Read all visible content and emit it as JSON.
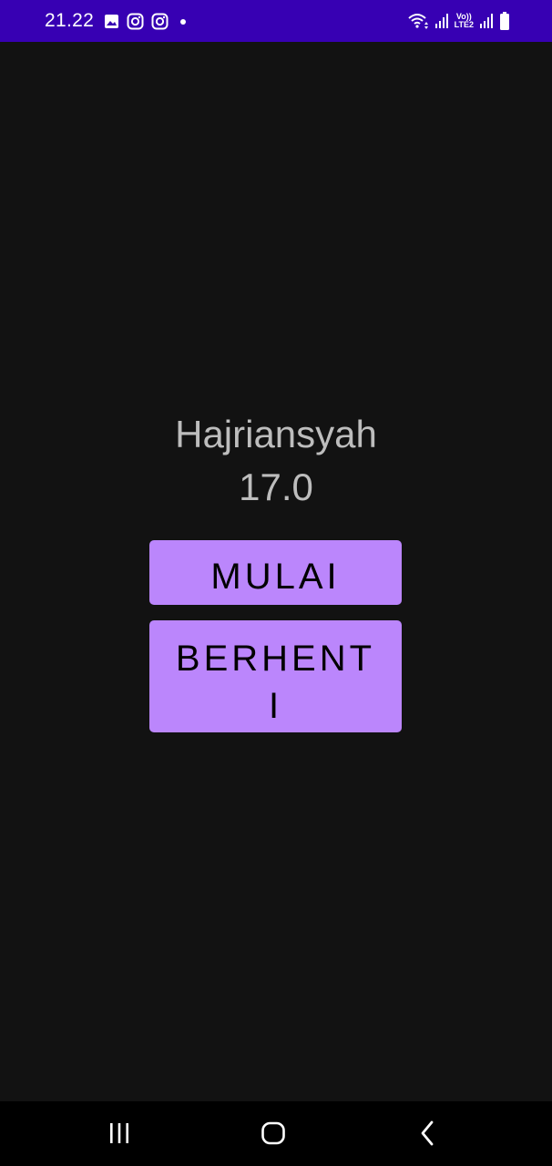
{
  "status_bar": {
    "time": "21.22",
    "lte_top": "Vo))",
    "lte_bottom": "LTE2",
    "background": "#3700B3",
    "icons_left": [
      "gallery-icon",
      "instagram-icon",
      "instagram-icon",
      "dot-icon"
    ],
    "icons_right": [
      "wifi-icon",
      "signal-icon",
      "volte-icon",
      "signal-icon",
      "battery-icon"
    ]
  },
  "main": {
    "name": "Hajriansyah",
    "value": "17.0",
    "start_button_label": "MULAI",
    "stop_button_label": "BERHENTI",
    "accent_color": "#BB86FC"
  },
  "nav_bar": {
    "items": [
      "recents-icon",
      "home-icon",
      "back-icon"
    ]
  }
}
